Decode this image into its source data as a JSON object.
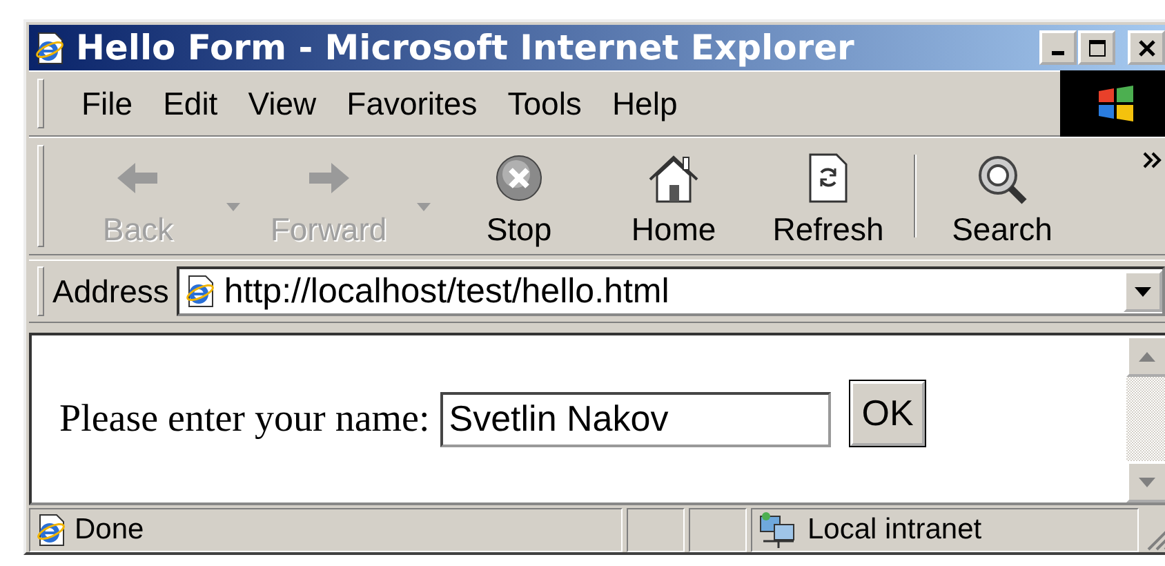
{
  "window": {
    "title": "Hello Form - Microsoft Internet Explorer"
  },
  "menu": [
    "File",
    "Edit",
    "View",
    "Favorites",
    "Tools",
    "Help"
  ],
  "toolbar": [
    {
      "label": "Back",
      "kind": "back",
      "disabled": true,
      "dropdown": true
    },
    {
      "label": "Forward",
      "kind": "forward",
      "disabled": true,
      "dropdown": true
    },
    {
      "label": "Stop",
      "kind": "stop",
      "disabled": false,
      "dropdown": false
    },
    {
      "label": "Home",
      "kind": "home",
      "disabled": false,
      "dropdown": false
    },
    {
      "label": "Refresh",
      "kind": "refresh",
      "disabled": false,
      "dropdown": false
    },
    {
      "label": "Search",
      "kind": "search",
      "disabled": false,
      "dropdown": false
    }
  ],
  "address": {
    "label": "Address",
    "url": "http://localhost/test/hello.html"
  },
  "page": {
    "prompt": "Please enter your name:",
    "name_field": {
      "value": "Svetlin Nakov"
    },
    "button": "OK"
  },
  "status_bar": {
    "text": "Done",
    "zone": "Local intranet"
  }
}
